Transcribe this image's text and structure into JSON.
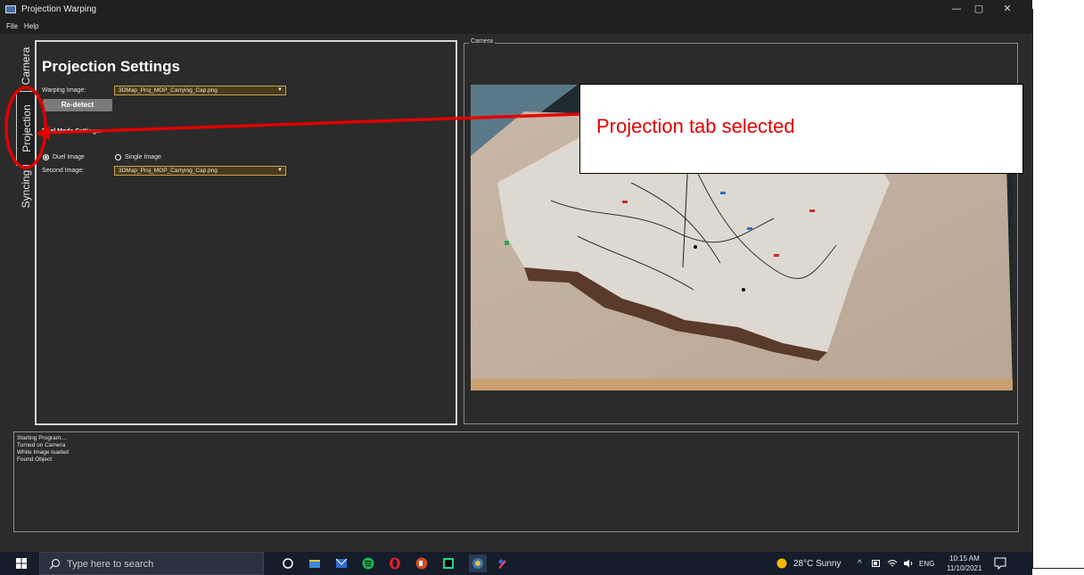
{
  "window": {
    "title": "Projection Warping",
    "minimize": "—",
    "maximize": "▢",
    "close": "✕"
  },
  "menu": {
    "file": "File",
    "help": "Help"
  },
  "tabs": {
    "camera": "Camera",
    "projection": "Projection",
    "syncing": "Syncing"
  },
  "settings": {
    "title": "Projection Settings",
    "warping_label": "Warping Image:",
    "warping_value": "3DMap_Proj_MOP_Carrying_Cap.png",
    "redetect": "Re-detect",
    "dual_mode_label": "Dual Mode Settings:",
    "dual_image": "Duel Image",
    "single_image": "Single Image",
    "second_label": "Second Image:",
    "second_value": "3DMap_Proj_MOP_Carrying_Cap.png"
  },
  "camera": {
    "title": "Camera"
  },
  "log": [
    "Starting Program....",
    "Turned on Camera",
    "White Image loaded",
    "Found Object"
  ],
  "taskbar": {
    "search_placeholder": "Type here to search",
    "weather": "28°C Sunny",
    "lang": "ENG",
    "time": "10:15 AM",
    "date": "11/10/2021"
  },
  "annotation": {
    "text": "Projection tab selected",
    "color": "#e00000"
  }
}
